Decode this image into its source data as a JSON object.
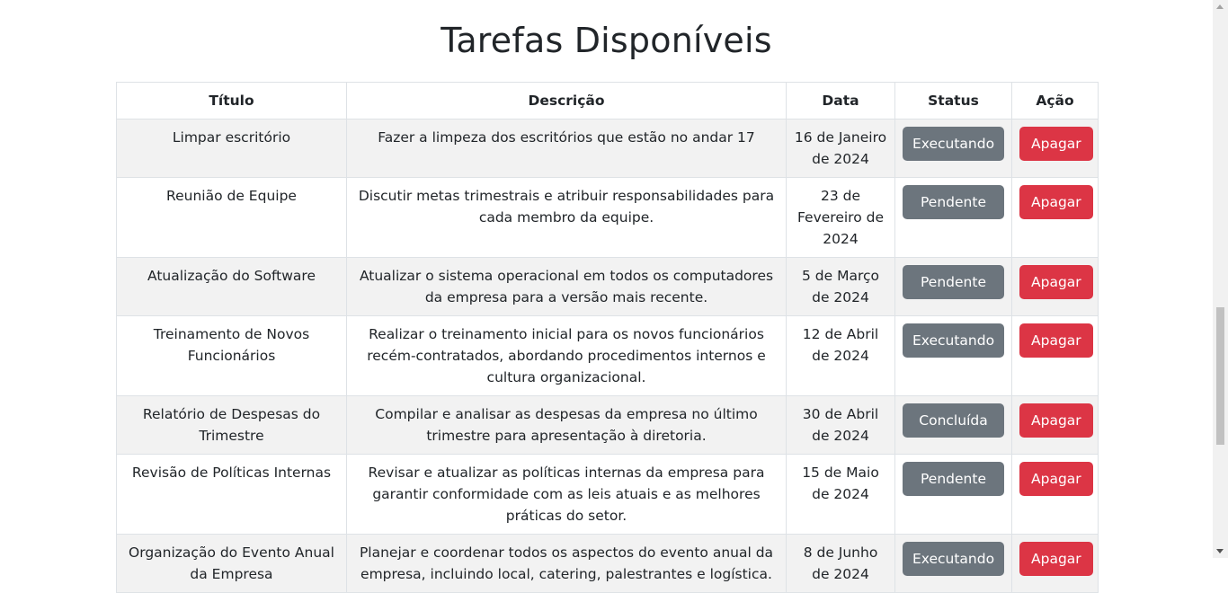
{
  "page": {
    "title": "Tarefas Disponíveis"
  },
  "table": {
    "headers": {
      "title": "Título",
      "description": "Descrição",
      "date": "Data",
      "status": "Status",
      "action": "Ação"
    },
    "rows": [
      {
        "title": "Limpar escritório",
        "description": "Fazer a limpeza dos escritórios que estão no andar 17",
        "date": "16 de Janeiro de 2024",
        "status": "Executando",
        "action": "Apagar"
      },
      {
        "title": "Reunião de Equipe",
        "description": "Discutir metas trimestrais e atribuir responsabilidades para cada membro da equipe.",
        "date": "23 de Fevereiro de 2024",
        "status": "Pendente",
        "action": "Apagar"
      },
      {
        "title": "Atualização do Software",
        "description": "Atualizar o sistema operacional em todos os computadores da empresa para a versão mais recente.",
        "date": "5 de Março de 2024",
        "status": "Pendente",
        "action": "Apagar"
      },
      {
        "title": "Treinamento de Novos Funcionários",
        "description": "Realizar o treinamento inicial para os novos funcionários recém-contratados, abordando procedimentos internos e cultura organizacional.",
        "date": "12 de Abril de 2024",
        "status": "Executando",
        "action": "Apagar"
      },
      {
        "title": "Relatório de Despesas do Trimestre",
        "description": "Compilar e analisar as despesas da empresa no último trimestre para apresentação à diretoria.",
        "date": "30 de Abril de 2024",
        "status": "Concluída",
        "action": "Apagar"
      },
      {
        "title": "Revisão de Políticas Internas",
        "description": "Revisar e atualizar as políticas internas da empresa para garantir conformidade com as leis atuais e as melhores práticas do setor.",
        "date": "15 de Maio de 2024",
        "status": "Pendente",
        "action": "Apagar"
      },
      {
        "title": "Organização do Evento Anual da Empresa",
        "description": "Planejar e coordenar todos os aspectos do evento anual da empresa, incluindo local, catering, palestrantes e logística.",
        "date": "8 de Junho de 2024",
        "status": "Executando",
        "action": "Apagar"
      }
    ]
  },
  "colors": {
    "status_button": "#6c757d",
    "delete_button": "#dc3545",
    "striped_row": "#f2f2f2",
    "border": "#dee2e6"
  }
}
